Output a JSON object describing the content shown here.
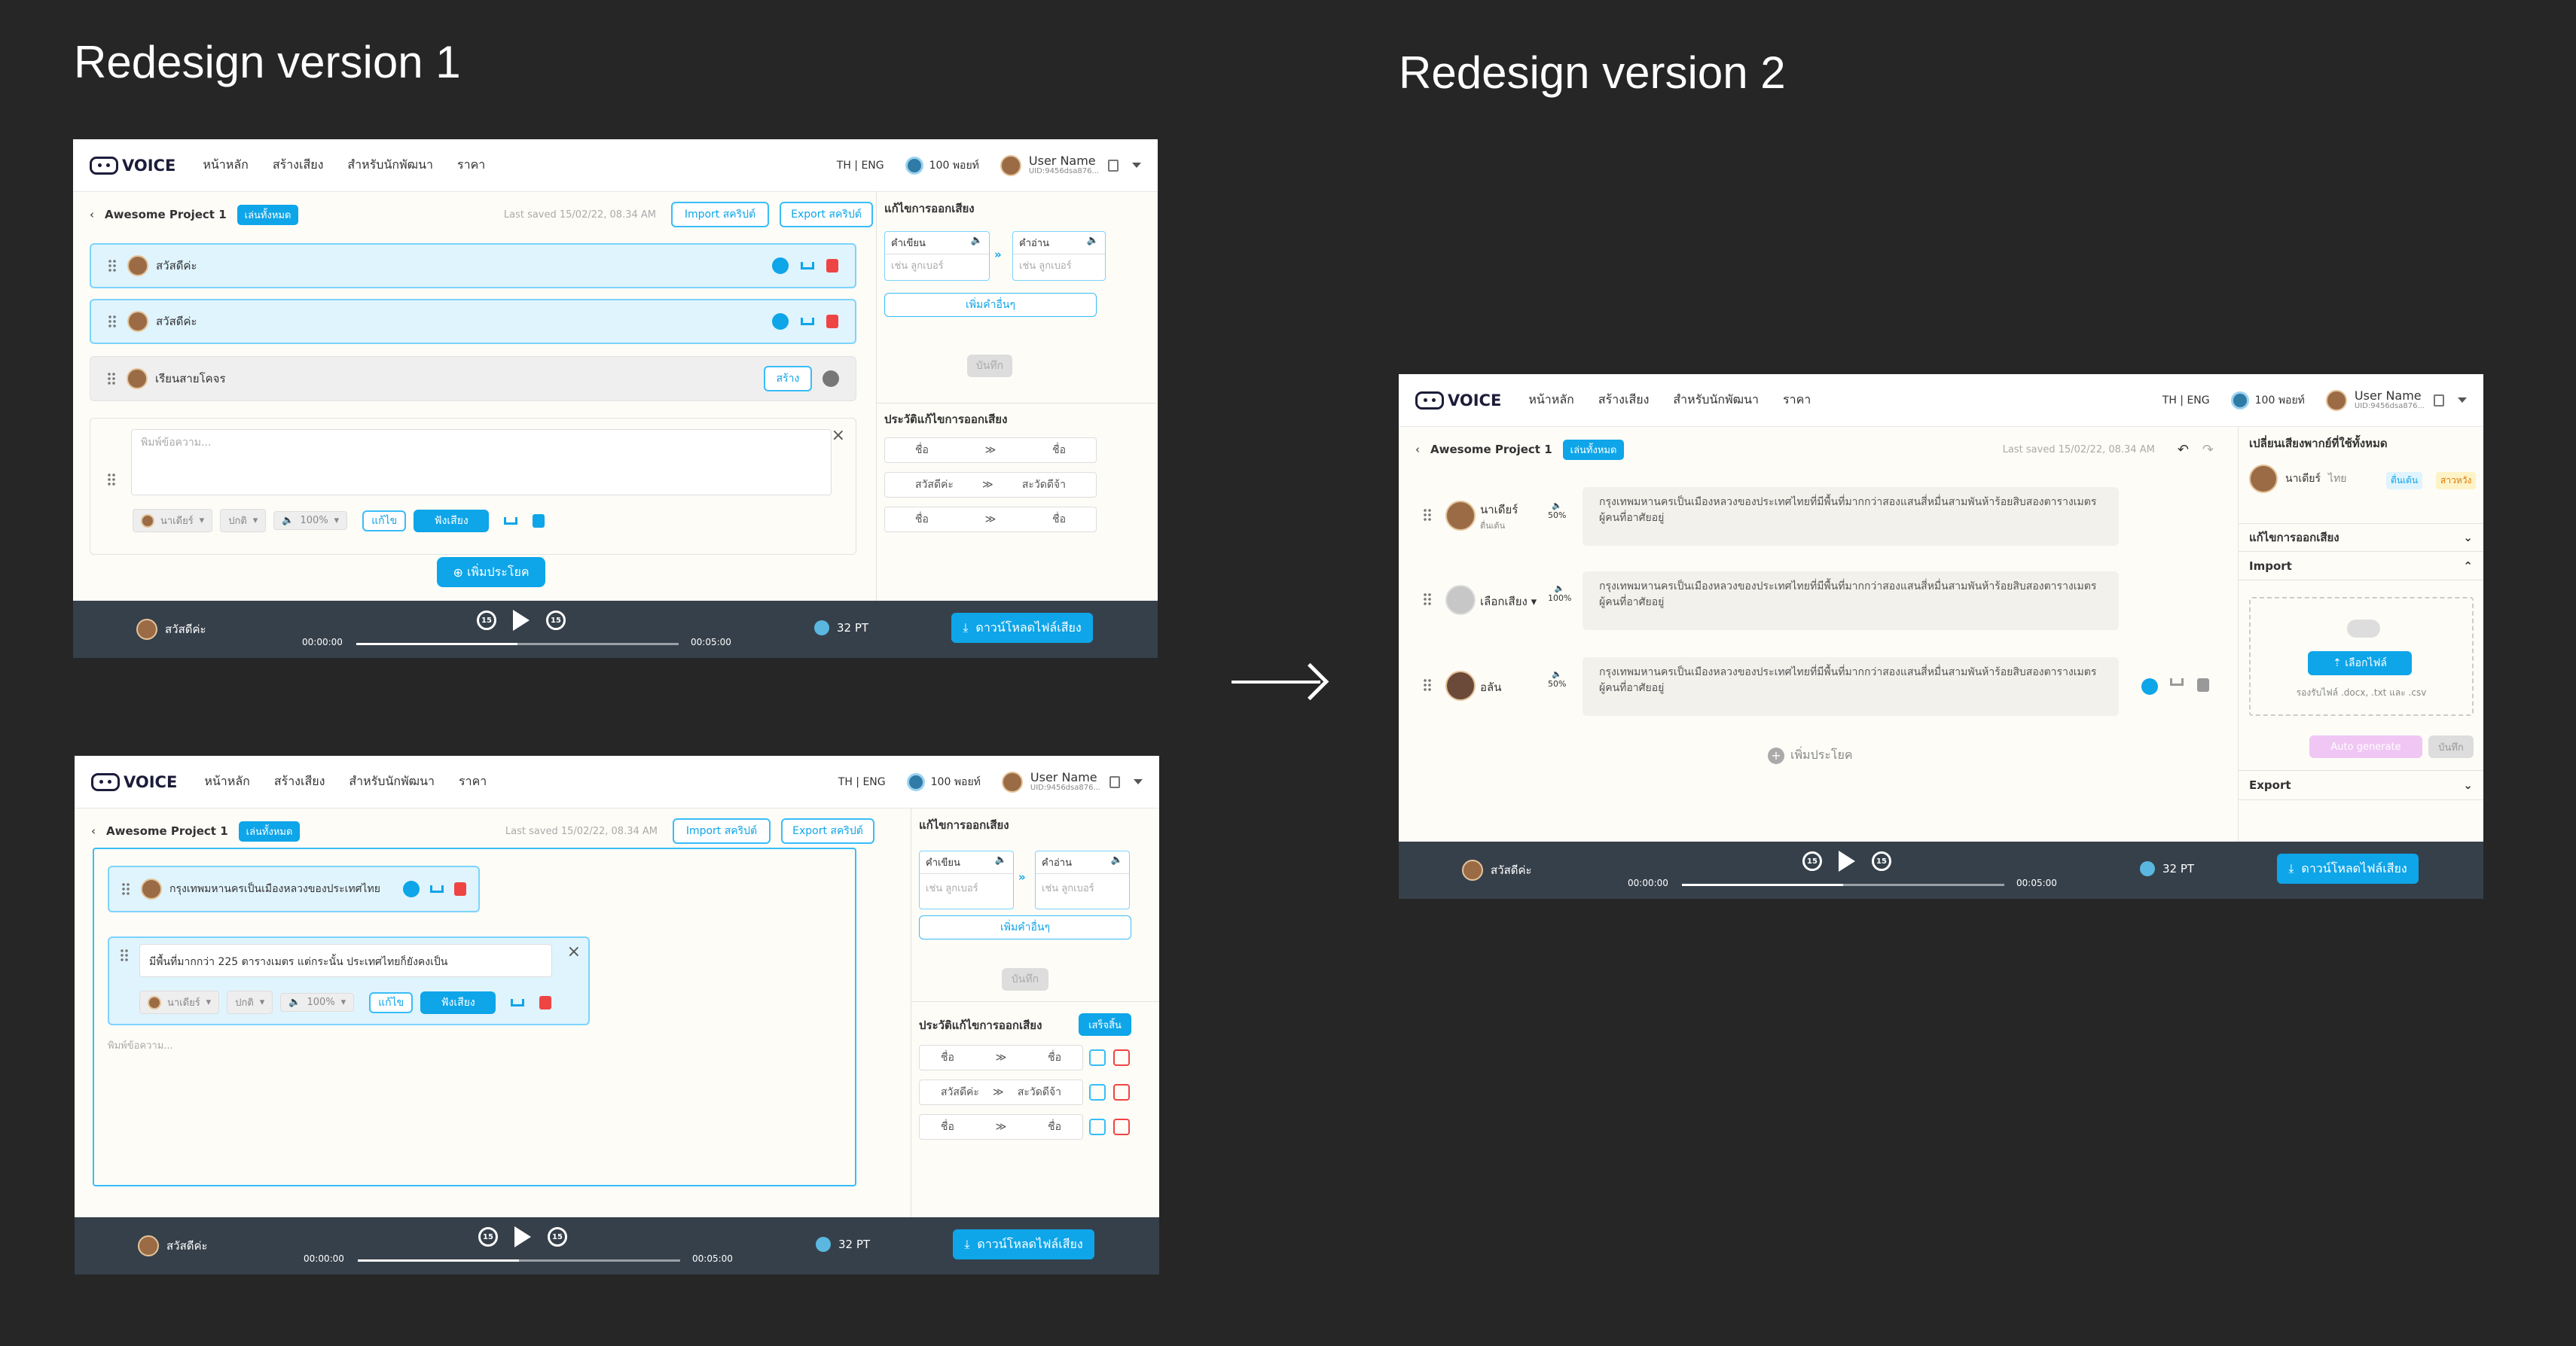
{
  "titles": {
    "v1": "Redesign version 1",
    "v2": "Redesign version 2"
  },
  "nav": {
    "logo": "VOICE",
    "items": [
      "หน้าหลัก",
      "สร้างเสียง",
      "สำหรับนักพัฒนา",
      "ราคา"
    ],
    "lang": "TH | ENG",
    "points": "100 พอยท์",
    "user_name": "User Name",
    "user_id": "UID:9456dsa876..."
  },
  "project": {
    "name": "Awesome Project 1",
    "play_all": "เล่นทั้งหมด",
    "last_saved": "Last saved 15/02/22, 08.34 AM",
    "import": "Import สคริปต์",
    "export": "Export สคริปต์"
  },
  "v1a": {
    "rows": [
      "สวัสดีค่ะ",
      "สวัสดีค่ะ",
      "เรียนสายโคจร"
    ],
    "create_btn": "สร้าง",
    "placeholder": "พิมพ์ข้อความ...",
    "voice": "นาเดียร์",
    "style": "ปกติ",
    "speed": "100%",
    "edit_btn": "แก้ไข",
    "gen_btn": "ฟังเสียง",
    "add_sentence": "เพิ่มประโยค"
  },
  "v1b": {
    "row1": "กรุงเทพมหานครเป็นเมืองหลวงของประเทศไทย",
    "row2": "มีพื้นที่มากกว่า 225 ตารางเมตร แต่กระนั้น ประเทศไทยก็ยังคงเป็น",
    "placeholder": "พิมพ์ข้อความ..."
  },
  "pron": {
    "title": "แก้ไขการออกเสียง",
    "word_label": "คำเขียน",
    "read_label": "คำอ่าน",
    "word_ph": "เช่น ลูกเบอร์",
    "read_ph": "เช่น ลูกเบอร์",
    "add_word": "เพิ่มคำอื่นๆ",
    "save": "บันทึก",
    "history_title": "ประวัติแก้ไขการออกเสียง",
    "history_btn": "เสร็จสิ้น",
    "history": [
      [
        "ชื่อ",
        "ชื่อ"
      ],
      [
        "สวัสดีค่ะ",
        "สะวัดดีจ้า"
      ],
      [
        "ชื่อ",
        "ชื่อ"
      ]
    ]
  },
  "player": {
    "speaker": "สวัสดีค่ะ",
    "start": "00:00:00",
    "end": "00:05:00",
    "points": "32 PT",
    "download": "ดาวน์โหลดไฟล์เสียง",
    "skip": "15",
    "progress": 0.5
  },
  "v2": {
    "lines": [
      {
        "voice": "นาเดียร์",
        "sub": "ตื่นเต้น",
        "vol": "50%",
        "text": "กรุงเทพมหานครเป็นเมืองหลวงของประเทศไทยที่มีพื้นที่มากกว่าสองแสนสี่หมื่นสามพันห้าร้อยสิบสองตารางเมตร ผู้คนที่อาศัยอยู่"
      },
      {
        "voice": "เลือกเสียง",
        "sub": "",
        "vol": "100%",
        "text": "กรุงเทพมหานครเป็นเมืองหลวงของประเทศไทยที่มีพื้นที่มากกว่าสองแสนสี่หมื่นสามพันห้าร้อยสิบสองตารางเมตร ผู้คนที่อาศัยอยู่"
      },
      {
        "voice": "อลัน",
        "sub": "",
        "vol": "50%",
        "text": "กรุงเทพมหานครเป็นเมืองหลวงของประเทศไทยที่มีพื้นที่มากกว่าสองแสนสี่หมื่นสามพันห้าร้อยสิบสองตารางเมตร ผู้คนที่อาศัยอยู่"
      }
    ],
    "add_sentence": "เพิ่มประโยค",
    "side_title": "เปลี่ยนเสียงพากย์ที่ใช้ทั้งหมด",
    "voice": "นาเดียร์",
    "voice_lang": "ไทย",
    "tag1": "ตื่นเต้น",
    "tag2": "สาวหวัง",
    "pron": "แก้ไขการออกเสียง",
    "import": "Import",
    "upload": "เลือกไฟล์",
    "support": "รองรับไฟล์ .docx, .txt และ .csv",
    "auto": "Auto generate",
    "save": "บันทึก",
    "export": "Export"
  }
}
